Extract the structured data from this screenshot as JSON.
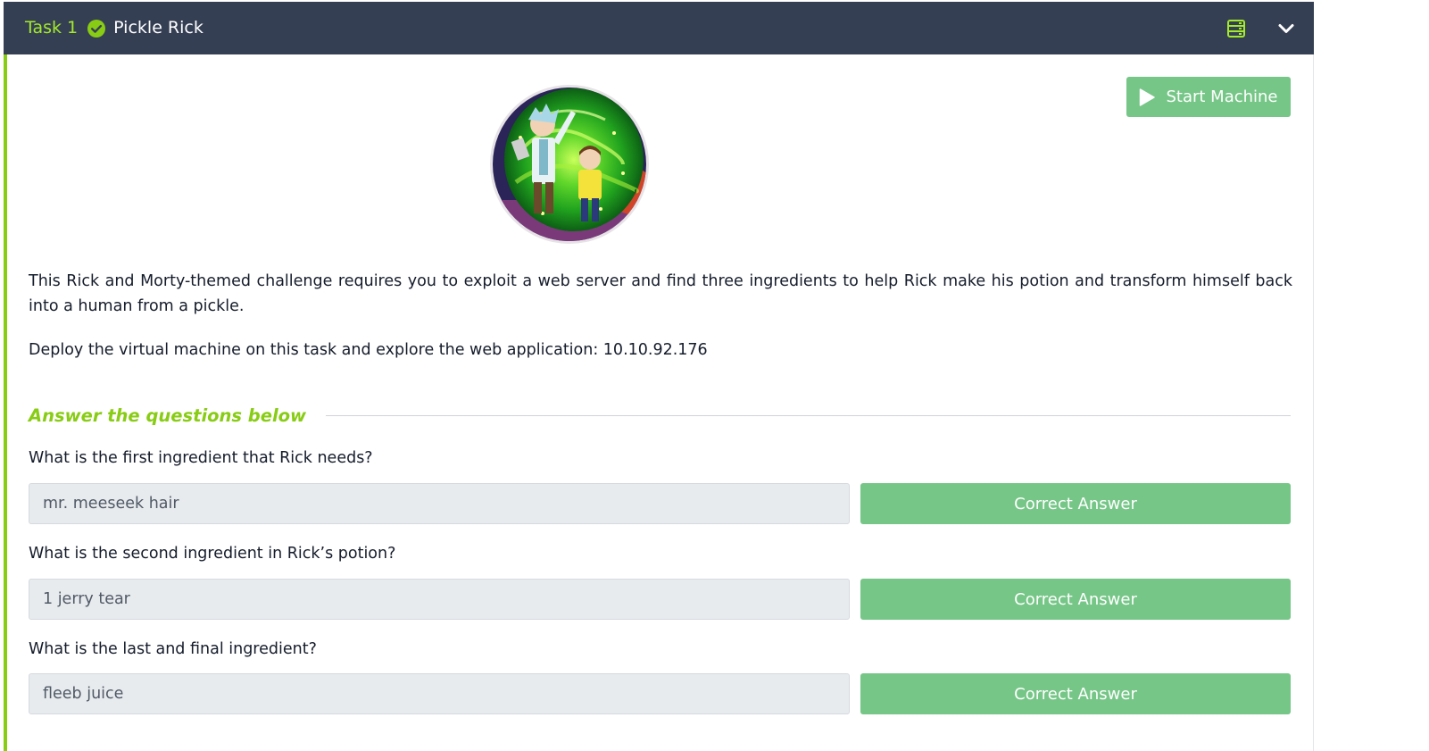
{
  "task": {
    "number_label": "Task 1",
    "title": "Pickle Rick",
    "completed": true,
    "accent_color": "#88cc14",
    "header_color": "#353f54"
  },
  "header_icons": {
    "notes": "notes-icon",
    "toggle": "chevron-down-icon"
  },
  "start_machine": {
    "label": "Start Machine",
    "icon": "play-icon",
    "color": "#76c687"
  },
  "image": {
    "description_name": "rick-and-morty-portal-image"
  },
  "description": {
    "paragraph_1": "This Rick and Morty-themed challenge requires you to exploit a web server and find three ingredients to help Rick make his potion and transform himself back into a human from a pickle.",
    "paragraph_2": "Deploy the virtual machine on this task and explore the web application: 10.10.92.176"
  },
  "answers_section": {
    "heading": "Answer the questions below"
  },
  "questions": [
    {
      "question": "What is the first ingredient that Rick needs?",
      "answer": "mr. meeseek hair",
      "button_label": "Correct Answer"
    },
    {
      "question": "What is the second ingredient in Rick’s potion?",
      "answer": "1 jerry tear",
      "button_label": "Correct Answer"
    },
    {
      "question": "What is the last and final ingredient?",
      "answer": "fleeb juice",
      "button_label": "Correct Answer"
    }
  ]
}
